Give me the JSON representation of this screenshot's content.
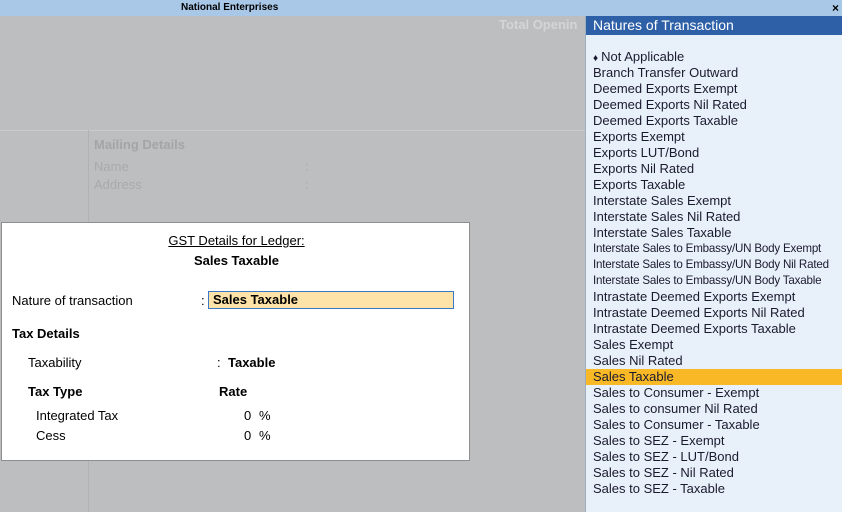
{
  "window": {
    "title": "National Enterprises",
    "close_glyph": "×"
  },
  "background": {
    "total_opening": "Total Openin",
    "mailing": {
      "heading": "Mailing Details",
      "name_label": "Name",
      "address_label": "Address",
      "colon": ":"
    }
  },
  "dialog": {
    "caption": "GST Details for Ledger:",
    "ledger_name": "Sales Taxable",
    "nature_label": "Nature of transaction",
    "colon": ":",
    "nature_value": "Sales Taxable",
    "tax_details_heading": "Tax Details",
    "taxability_label": "Taxability",
    "taxability_value": "Taxable",
    "tax_type_header": "Tax Type",
    "rate_header": "Rate",
    "rows": [
      {
        "name": "Integrated Tax",
        "rate": "0",
        "unit": "%"
      },
      {
        "name": "Cess",
        "rate": "0",
        "unit": "%"
      }
    ]
  },
  "panel": {
    "title": "Natures of Transaction",
    "marker": "♦",
    "selected_index": 20,
    "items": [
      "Not Applicable",
      "Branch Transfer Outward",
      "Deemed Exports Exempt",
      "Deemed Exports Nil Rated",
      "Deemed Exports Taxable",
      "Exports Exempt",
      "Exports LUT/Bond",
      "Exports Nil Rated",
      "Exports Taxable",
      "Interstate Sales Exempt",
      "Interstate Sales Nil Rated",
      "Interstate Sales Taxable",
      "Interstate Sales to Embassy/UN Body Exempt",
      "Interstate Sales to Embassy/UN Body Nil Rated",
      "Interstate Sales to Embassy/UN Body Taxable",
      "Intrastate Deemed Exports Exempt",
      "Intrastate Deemed Exports Nil Rated",
      "Intrastate Deemed Exports Taxable",
      "Sales Exempt",
      "Sales Nil Rated",
      "Sales Taxable",
      "Sales to Consumer - Exempt",
      "Sales to consumer Nil Rated",
      "Sales to Consumer - Taxable",
      "Sales to SEZ - Exempt",
      "Sales to SEZ - LUT/Bond",
      "Sales to SEZ - Nil Rated",
      "Sales to SEZ - Taxable"
    ]
  }
}
